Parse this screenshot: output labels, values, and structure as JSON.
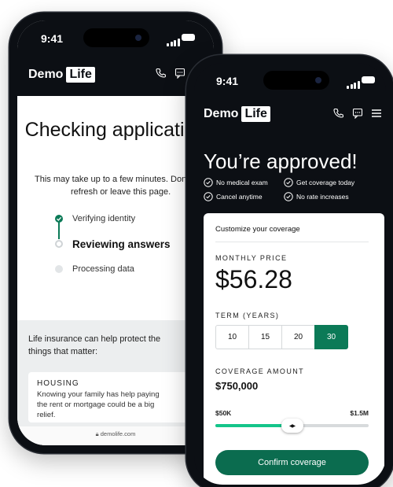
{
  "back_phone": {
    "status_time": "9:41",
    "brand": {
      "demo": "Demo",
      "life": "Life"
    },
    "title": "Checking application",
    "subtitle_line1": "This may take up to a few minutes. Don",
    "subtitle_line2": "refresh or leave this page.",
    "steps": [
      {
        "label": "Verifying identity",
        "state": "done"
      },
      {
        "label": "Reviewing answers",
        "state": "active"
      },
      {
        "label": "Processing data",
        "state": "pending"
      }
    ],
    "promo_heading": "Life insurance can help protect the things that matter:",
    "housing": {
      "tag": "HOUSING",
      "text": "Knowing your family has help paying the rent or mortgage could be a big relief."
    },
    "url": "demolife.com"
  },
  "front_phone": {
    "status_time": "9:41",
    "brand": {
      "demo": "Demo",
      "life": "Life"
    },
    "title": "You’re approved!",
    "benefits": [
      "No medical exam",
      "Get coverage today",
      "Cancel anytime",
      "No rate increases"
    ],
    "card_title": "Customize your coverage",
    "monthly_price_label": "MONTHLY PRICE",
    "monthly_price": "$56.28",
    "term_label": "TERM (YEARS)",
    "terms": [
      "10",
      "15",
      "20",
      "30"
    ],
    "selected_term": "30",
    "coverage_label": "COVERAGE AMOUNT",
    "coverage_amount": "$750,000",
    "slider_min": "$50K",
    "slider_max": "$1.5M",
    "slider_position": 0.5,
    "confirm_label": "Confirm coverage"
  },
  "colors": {
    "brand_green": "#0b7a57",
    "slider_fill": "#14c58a",
    "dark_bg": "#0c0f14"
  }
}
